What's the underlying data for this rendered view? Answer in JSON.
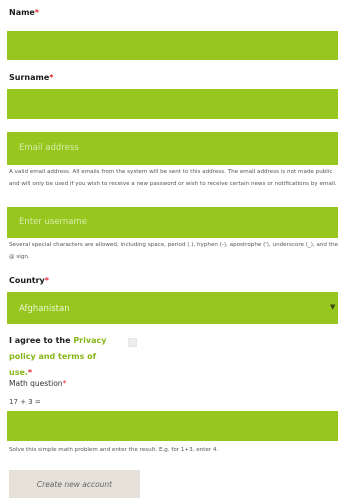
{
  "form": {
    "name_label": "Name",
    "surname_label": "Surname",
    "required_mark": "*",
    "email_placeholder": "Email address",
    "email_description": "A valid email address. All emails from the system will be sent to this address. The email address is not made public and will only be used if you wish to receive a new password or wish to receive certain news or notifications by email.",
    "username_placeholder": "Enter username",
    "username_description": "Several special characters are allowed, including space, period (.), hyphen (-), apostrophe ('), underscore (_), and the @ sign.",
    "country_label": "Country",
    "country_selected": "Afghanistan",
    "agree_prefix": "I agree to the ",
    "agree_link": "Privacy policy and terms of use.",
    "math_label": "Math question",
    "math_question": "17 + 3 =",
    "math_description": "Solve this simple math problem and enter the result. E.g. for 1+3, enter 4.",
    "submit_label": "Create new account"
  },
  "colors": {
    "field_green": "#97c61f",
    "required_red": "#e0242b",
    "link_green": "#88b51a",
    "button_bg": "#e5e1d9"
  },
  "icons": {
    "select_caret": "caret-down-icon"
  }
}
